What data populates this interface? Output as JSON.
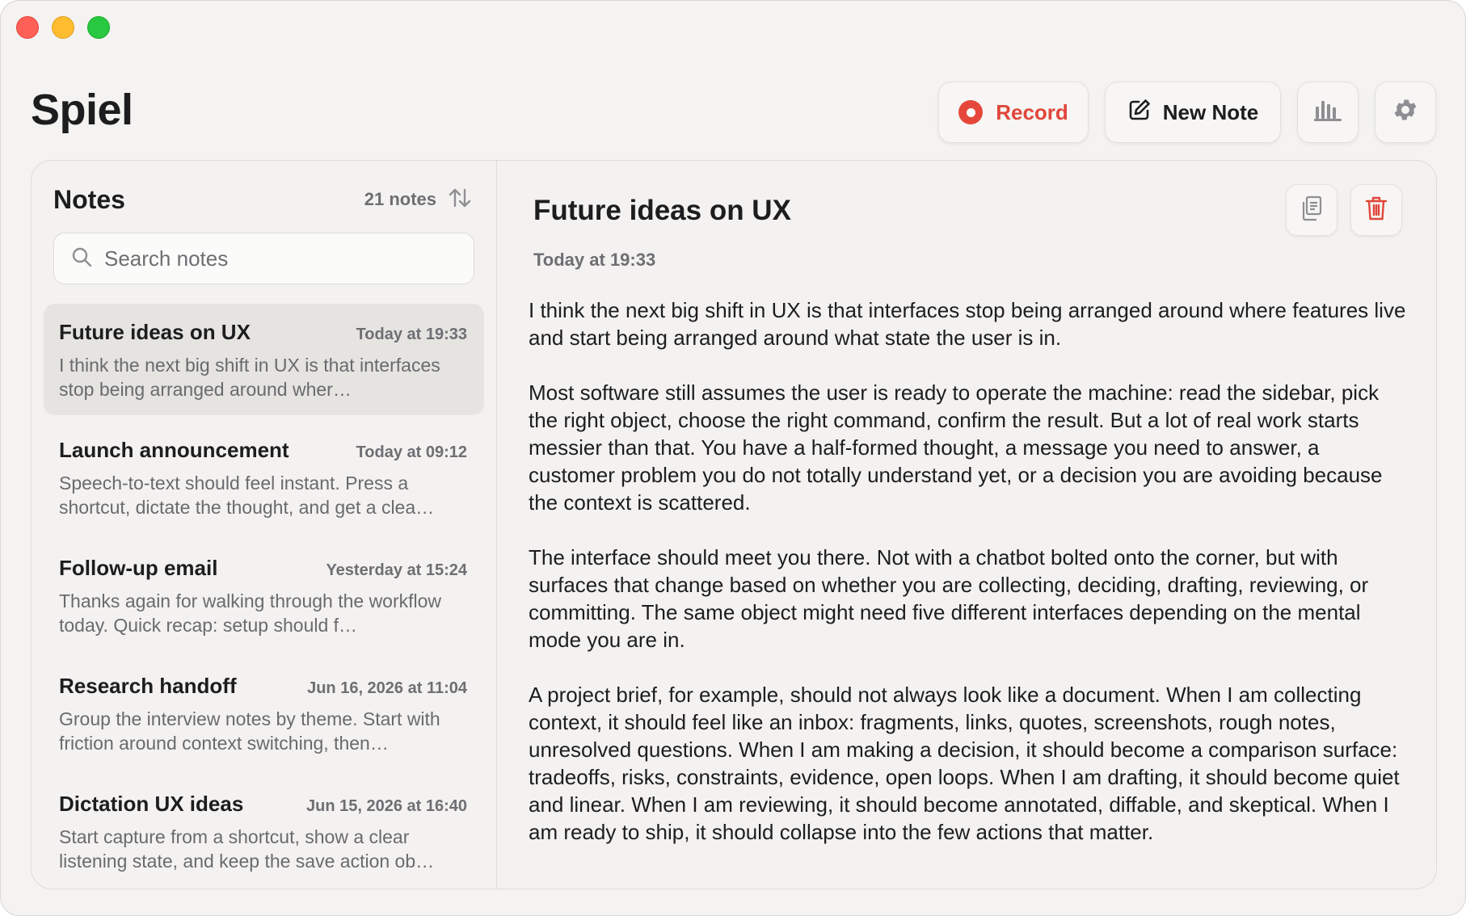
{
  "app": {
    "title": "Spiel"
  },
  "toolbar": {
    "record_label": "Record",
    "new_note_label": "New Note",
    "stats_icon": "bar-chart-icon",
    "settings_icon": "gear-icon"
  },
  "sidebar": {
    "title": "Notes",
    "count_label": "21 notes",
    "search_placeholder": "Search notes",
    "notes": [
      {
        "title": "Future ideas on UX",
        "date": "Today at 19:33",
        "preview": "I think the next big shift in UX is that interfaces stop being arranged around wher…"
      },
      {
        "title": "Launch announcement",
        "date": "Today at 09:12",
        "preview": "Speech-to-text should feel instant.  Press a shortcut, dictate the thought, and get a clea…"
      },
      {
        "title": "Follow-up email",
        "date": "Yesterday at 15:24",
        "preview": "Thanks again for walking through the workflow today. Quick recap: setup should f…"
      },
      {
        "title": "Research handoff",
        "date": "Jun 16, 2026 at 11:04",
        "preview": "Group the interview notes by theme. Start with friction around context switching, then…"
      },
      {
        "title": "Dictation UX ideas",
        "date": "Jun 15, 2026 at 16:40",
        "preview": "Start capture from a shortcut, show a clear listening state, and keep the save action ob…"
      }
    ]
  },
  "detail": {
    "title": "Future ideas on UX",
    "date": "Today at 19:33",
    "paragraphs": [
      "I think the next big shift in UX is that interfaces stop being arranged around where features live and start being arranged around what state the user is in.",
      "Most software still assumes the user is ready to operate the machine: read the sidebar, pick the right object, choose the right command, confirm the result. But a lot of real work starts messier than that. You have a half-formed thought, a message you need to answer, a customer problem you do not totally understand yet, or a decision you are avoiding because the context is scattered.",
      "The interface should meet you there. Not with a chatbot bolted onto the corner, but with surfaces that change based on whether you are collecting, deciding, drafting, reviewing, or committing. The same object might need five different interfaces depending on the mental mode you are in.",
      "A project brief, for example, should not always look like a document. When I am collecting context, it should feel like an inbox: fragments, links, quotes, screenshots, rough notes, unresolved questions. When I am making a decision, it should become a comparison surface: tradeoffs, risks, constraints, evidence, open loops. When I am drafting, it should become quiet and linear. When I am reviewing, it should become annotated, diffable, and skeptical. When I am ready to ship, it should collapse into the few actions that matter."
    ]
  },
  "colors": {
    "accent_red": "#e5483b",
    "window_bg": "#f4f3f1",
    "selected_bg": "#e5e4e1"
  }
}
